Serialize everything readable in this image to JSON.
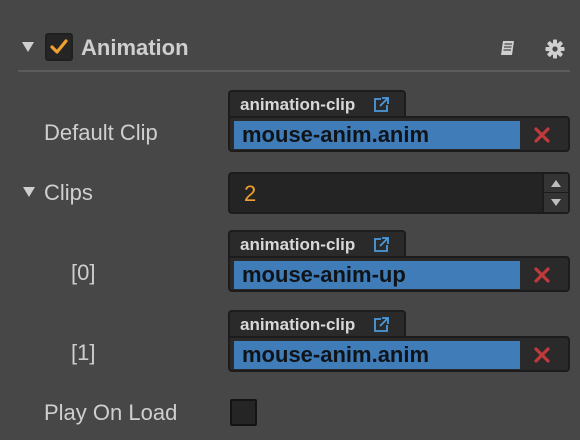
{
  "component": {
    "title": "Animation",
    "enabled": true,
    "icons": {
      "collapse": "triangle-down-icon",
      "check": "checkmark-icon",
      "help": "book-icon",
      "settings": "gear-icon"
    }
  },
  "default_clip": {
    "label": "Default Clip",
    "type_tag": "animation-clip",
    "value": "mouse-anim.anim"
  },
  "clips": {
    "label": "Clips",
    "count": "2",
    "items": [
      {
        "label": "[0]",
        "type_tag": "animation-clip",
        "value": "mouse-anim-up"
      },
      {
        "label": "[1]",
        "type_tag": "animation-clip",
        "value": "mouse-anim.anim"
      }
    ]
  },
  "play_on_load": {
    "label": "Play On Load",
    "checked": false
  },
  "colors": {
    "background": "#474747",
    "accent_orange": "#f0a030",
    "asset_blue": "#3f7cb8",
    "clear_red": "#c0393b"
  }
}
